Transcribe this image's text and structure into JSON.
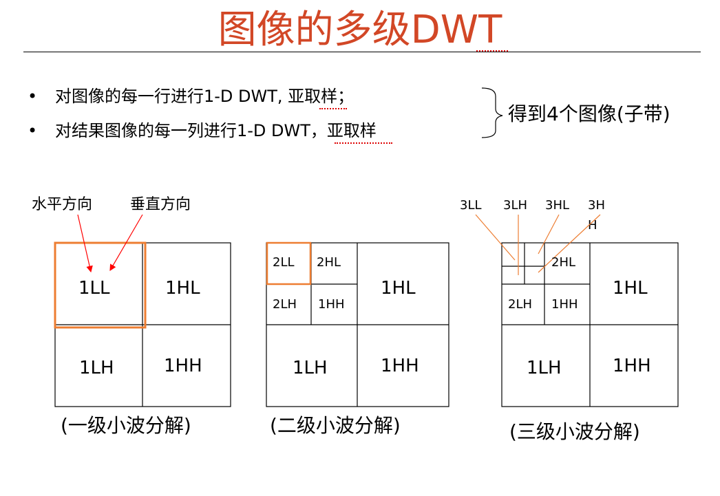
{
  "title": "图像的多级DWT",
  "bullets": [
    "对图像的每一行进行1-D DWT, 亚取样；",
    "对结果图像的每一列进行1-D DWT，亚取样"
  ],
  "bullet_symbol": "•",
  "result": "得到4个图像(子带)",
  "labels": {
    "horizontal": "水平方向",
    "vertical": "垂直方向"
  },
  "level3_labels": [
    "3LL",
    "3LH",
    "3HL",
    "3H",
    "H"
  ],
  "panel1": {
    "ll": "1LL",
    "hl": "1HL",
    "lh": "1LH",
    "hh": "1HH",
    "caption": "(一级小波分解)"
  },
  "panel2": {
    "ll2": "2LL",
    "hl2": "2HL",
    "lh2": "2LH",
    "hh2": "1HH",
    "hl": "1HL",
    "lh": "1LH",
    "hh": "1HH",
    "caption": "(二级小波分解)"
  },
  "panel3": {
    "hl2": "2HL",
    "lh2": "2LH",
    "hh2": "1HH",
    "hl": "1HL",
    "lh": "1LH",
    "hh": "1HH",
    "caption": "(三级小波分解)"
  },
  "colors": {
    "title": "#d24726",
    "highlight": "#ed7d31",
    "arrow": "#ff0000",
    "pointer": "#ed7d31"
  }
}
